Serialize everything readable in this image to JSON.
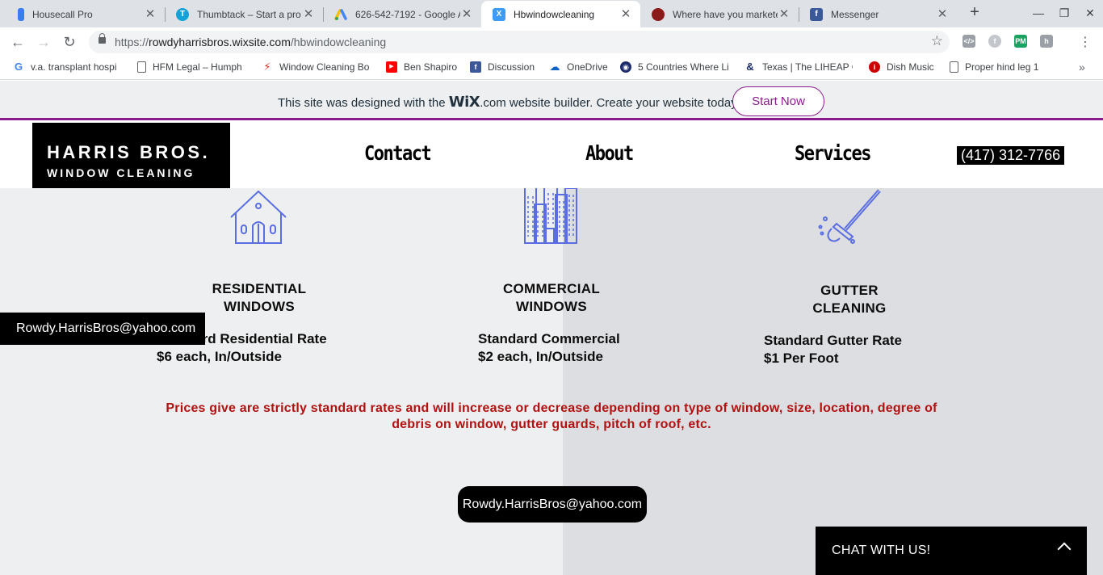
{
  "browser": {
    "tabs": [
      {
        "title": "Housecall Pro",
        "icon": "housecall-pro-icon",
        "color": "#3d7cf0",
        "glyph": ""
      },
      {
        "title": "Thumbtack – Start a pro",
        "icon": "thumbtack-icon",
        "color": "#16a2d6",
        "glyph": "T"
      },
      {
        "title": "626-542-7192 - Google A",
        "icon": "google-ads-icon",
        "color": "#fbbc04",
        "glyph": ""
      },
      {
        "title": "Hbwindowcleaning",
        "icon": "wix-icon",
        "color": "#3d9bf5",
        "glyph": "X"
      },
      {
        "title": "Where have you markete",
        "icon": "profile-icon",
        "color": "#8b1a1a",
        "glyph": ""
      },
      {
        "title": "Messenger",
        "icon": "facebook-icon",
        "color": "#3b5998",
        "glyph": "f"
      }
    ],
    "url_host": "rowdyharrisbros.wixsite.com",
    "url_path": "/hbwindowcleaning",
    "url_scheme": "https://",
    "bookmarks": [
      {
        "label": "v.a. transplant hospi",
        "icon": "google-icon",
        "color": "#4285f4",
        "glyph": "G"
      },
      {
        "label": "HFM Legal – Humph",
        "icon": "page-icon",
        "color": "#ffffff",
        "glyph": ""
      },
      {
        "label": "Window Cleaning Bo",
        "icon": "window-cleaning-icon",
        "color": "#d93025",
        "glyph": ""
      },
      {
        "label": "Ben Shapiro",
        "icon": "youtube-icon",
        "color": "#ff0000",
        "glyph": "▶"
      },
      {
        "label": "Discussion",
        "icon": "facebook-icon",
        "color": "#3b5998",
        "glyph": "f"
      },
      {
        "label": "OneDrive",
        "icon": "onedrive-icon",
        "color": "#0b62c4",
        "glyph": "☁"
      },
      {
        "label": "5 Countries Where Li",
        "icon": "site-icon",
        "color": "#1c2b6b",
        "glyph": "◉"
      },
      {
        "label": "Texas | The LIHEAP C",
        "icon": "liheap-icon",
        "color": "#1c2b6b",
        "glyph": "&"
      },
      {
        "label": "Dish Music",
        "icon": "dish-icon",
        "color": "#cc0000",
        "glyph": "i"
      },
      {
        "label": "Proper hind leg 1",
        "icon": "page-icon",
        "color": "#ffffff",
        "glyph": ""
      }
    ]
  },
  "wix_banner": {
    "text_before": "This site was designed with the",
    "logo_wix": "WiX",
    "logo_suffix": ".com",
    "text_after": "website builder. Create your website today.",
    "cta": "Start Now"
  },
  "header": {
    "logo_line1": "HARRIS BROS.",
    "logo_line2": "WINDOW CLEANING",
    "nav": [
      "Contact",
      "About",
      "Services"
    ],
    "phone": "(417) 312-7766"
  },
  "services": [
    {
      "title_line1": "RESIDENTIAL",
      "title_line2": "WINDOWS",
      "rate_line1": "Standard Residential Rate",
      "rate_line2": "$6 each, In/Outside",
      "icon": "house-icon"
    },
    {
      "title_line1": "COMMERCIAL",
      "title_line2": "WINDOWS",
      "rate_line1": "Standard Commercial",
      "rate_line2": "$2 each, In/Outside",
      "icon": "buildings-icon"
    },
    {
      "title_line1": "GUTTER",
      "title_line2": "CLEANING",
      "rate_line1": "Standard Gutter Rate",
      "rate_line2": "$1 Per Foot",
      "icon": "squeegee-icon"
    }
  ],
  "disclaimer": "Prices give are strictly standard rates and will increase or decrease depending on type of window, size, location, degree of debris on window, gutter guards, pitch of roof, etc.",
  "email": "Rowdy.HarrisBros@yahoo.com",
  "floating_email": "Rowdy.HarrisBros@yahoo.com",
  "chat_label": "CHAT WITH US!",
  "colors": {
    "accent": "#891b8e",
    "disclaimer": "#b01111",
    "icon_stroke": "#5b6ee1"
  }
}
